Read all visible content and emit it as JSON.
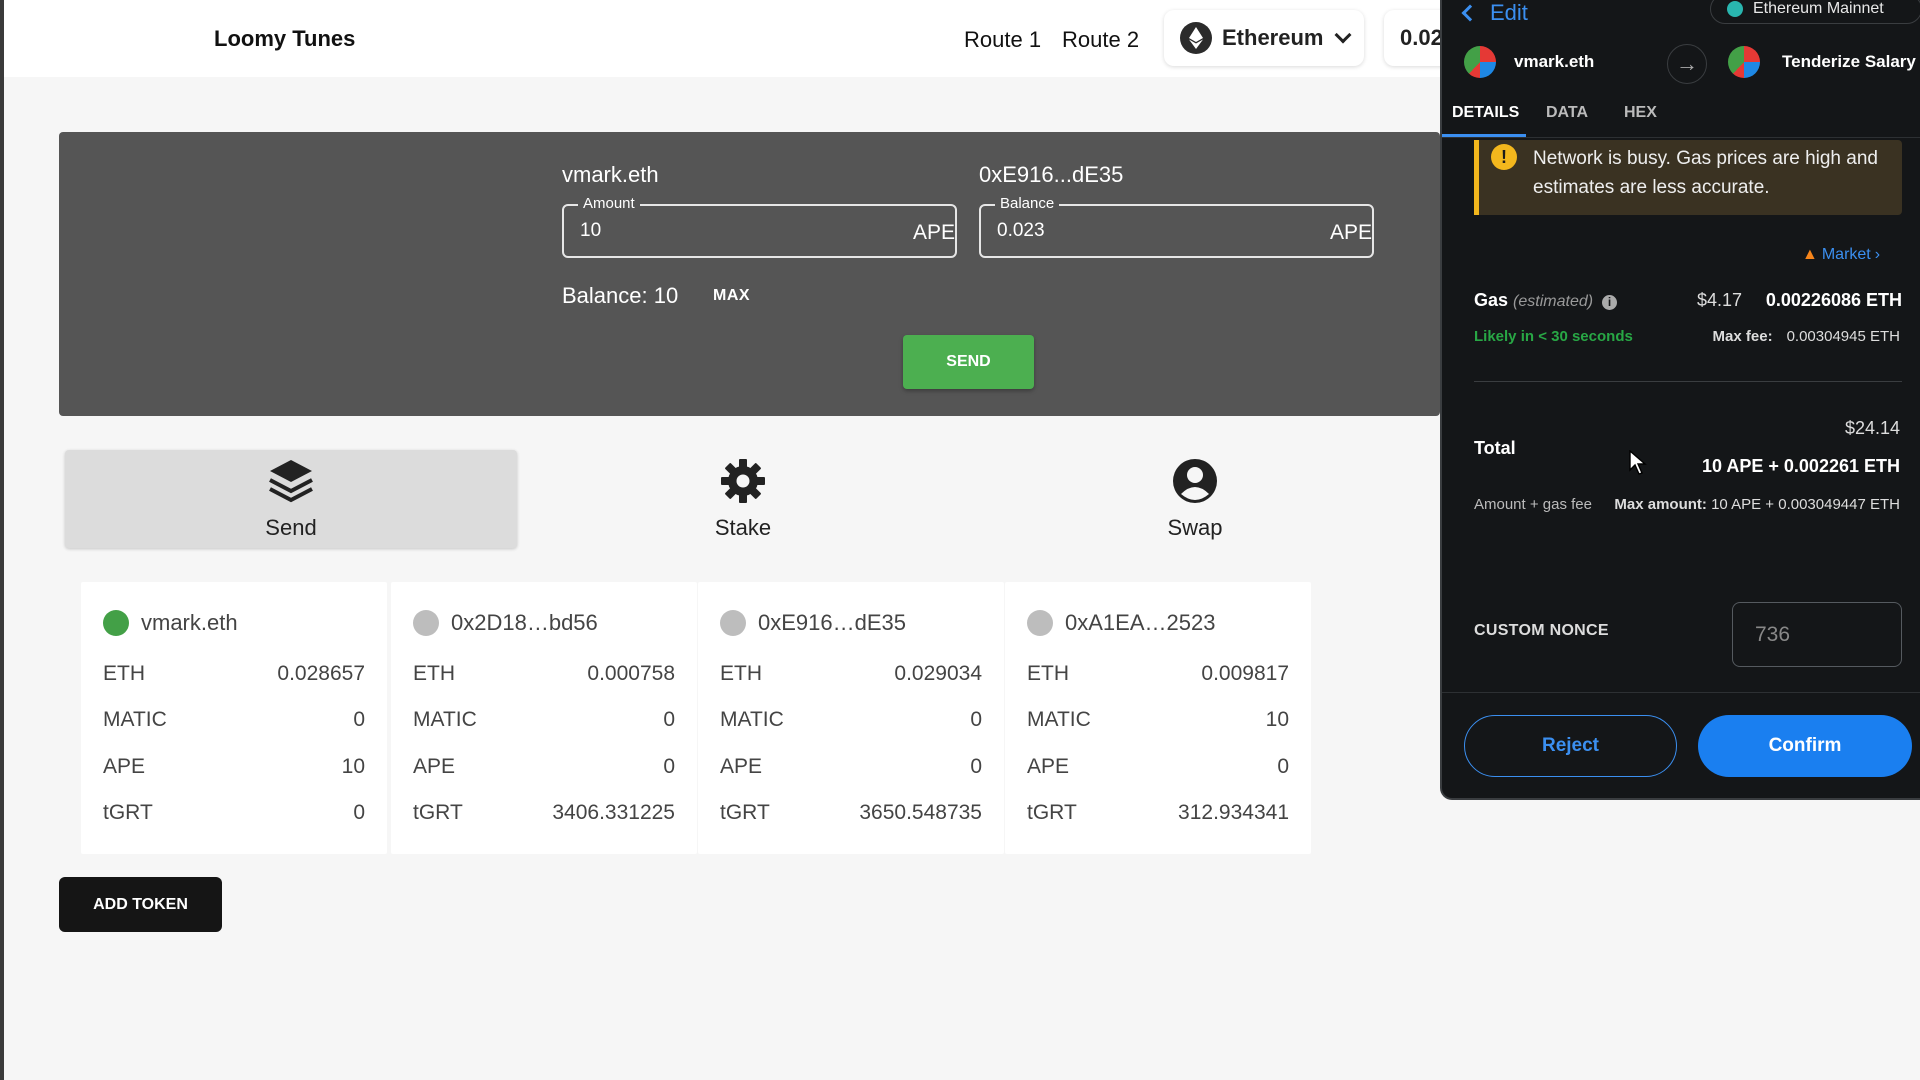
{
  "header": {
    "brand": "Loomy Tunes",
    "routes": [
      "Route 1",
      "Route 2"
    ],
    "network": "Ethereum",
    "balance_partial": "0.02"
  },
  "send_panel": {
    "from_name": "vmark.eth",
    "to_address": "0xE916...dE35",
    "amount_label": "Amount",
    "amount_value": "10",
    "amount_unit": "APE",
    "balance_label": "Balance",
    "balance_value": "0.023",
    "balance_unit": "APE",
    "balance_text": "Balance: 10",
    "max_label": "MAX",
    "send_label": "SEND"
  },
  "actions": [
    {
      "label": "Send",
      "icon": "layers-icon",
      "active": true
    },
    {
      "label": "Stake",
      "icon": "gear-icon",
      "active": false
    },
    {
      "label": "Swap",
      "icon": "user-icon",
      "active": false
    }
  ],
  "accounts": [
    {
      "name": "vmark.eth",
      "active": true,
      "tokens": [
        {
          "symbol": "ETH",
          "amount": "0.028657"
        },
        {
          "symbol": "MATIC",
          "amount": "0"
        },
        {
          "symbol": "APE",
          "amount": "10"
        },
        {
          "symbol": "tGRT",
          "amount": "0"
        }
      ]
    },
    {
      "name": "0x2D18…bd56",
      "active": false,
      "tokens": [
        {
          "symbol": "ETH",
          "amount": "0.000758"
        },
        {
          "symbol": "MATIC",
          "amount": "0"
        },
        {
          "symbol": "APE",
          "amount": "0"
        },
        {
          "symbol": "tGRT",
          "amount": "3406.331225"
        }
      ]
    },
    {
      "name": "0xE916…dE35",
      "active": false,
      "tokens": [
        {
          "symbol": "ETH",
          "amount": "0.029034"
        },
        {
          "symbol": "MATIC",
          "amount": "0"
        },
        {
          "symbol": "APE",
          "amount": "0"
        },
        {
          "symbol": "tGRT",
          "amount": "3650.548735"
        }
      ]
    },
    {
      "name": "0xA1EA…2523",
      "active": false,
      "tokens": [
        {
          "symbol": "ETH",
          "amount": "0.009817"
        },
        {
          "symbol": "MATIC",
          "amount": "10"
        },
        {
          "symbol": "APE",
          "amount": "0"
        },
        {
          "symbol": "tGRT",
          "amount": "312.934341"
        }
      ]
    }
  ],
  "add_token_label": "ADD TOKEN",
  "wallet": {
    "edit_label": "Edit",
    "network": "Ethereum Mainnet",
    "from_account": "vmark.eth",
    "to_account": "Tenderize Salary",
    "tabs": [
      "DETAILS",
      "DATA",
      "HEX"
    ],
    "warning": "Network is busy. Gas prices are high and estimates are less accurate.",
    "market_label": "Market",
    "gas_label": "Gas",
    "gas_estimated": "(estimated)",
    "gas_usd": "$4.17",
    "gas_eth": "0.00226086 ETH",
    "likely": "Likely in < 30 seconds",
    "max_fee_label": "Max fee:",
    "max_fee_value": "0.00304945 ETH",
    "total_usd": "$24.14",
    "total_label": "Total",
    "total_amount": "10 APE + 0.002261 ETH",
    "amount_gas_label": "Amount + gas fee",
    "max_amount_label": "Max amount:",
    "max_amount_value": "10 APE + 0.003049447 ETH",
    "nonce_label": "CUSTOM NONCE",
    "nonce_placeholder": "736",
    "reject_label": "Reject",
    "confirm_label": "Confirm",
    "accent_color": "#1a7ff0",
    "warning_color": "#f3b71d",
    "success_color": "#28a745"
  }
}
